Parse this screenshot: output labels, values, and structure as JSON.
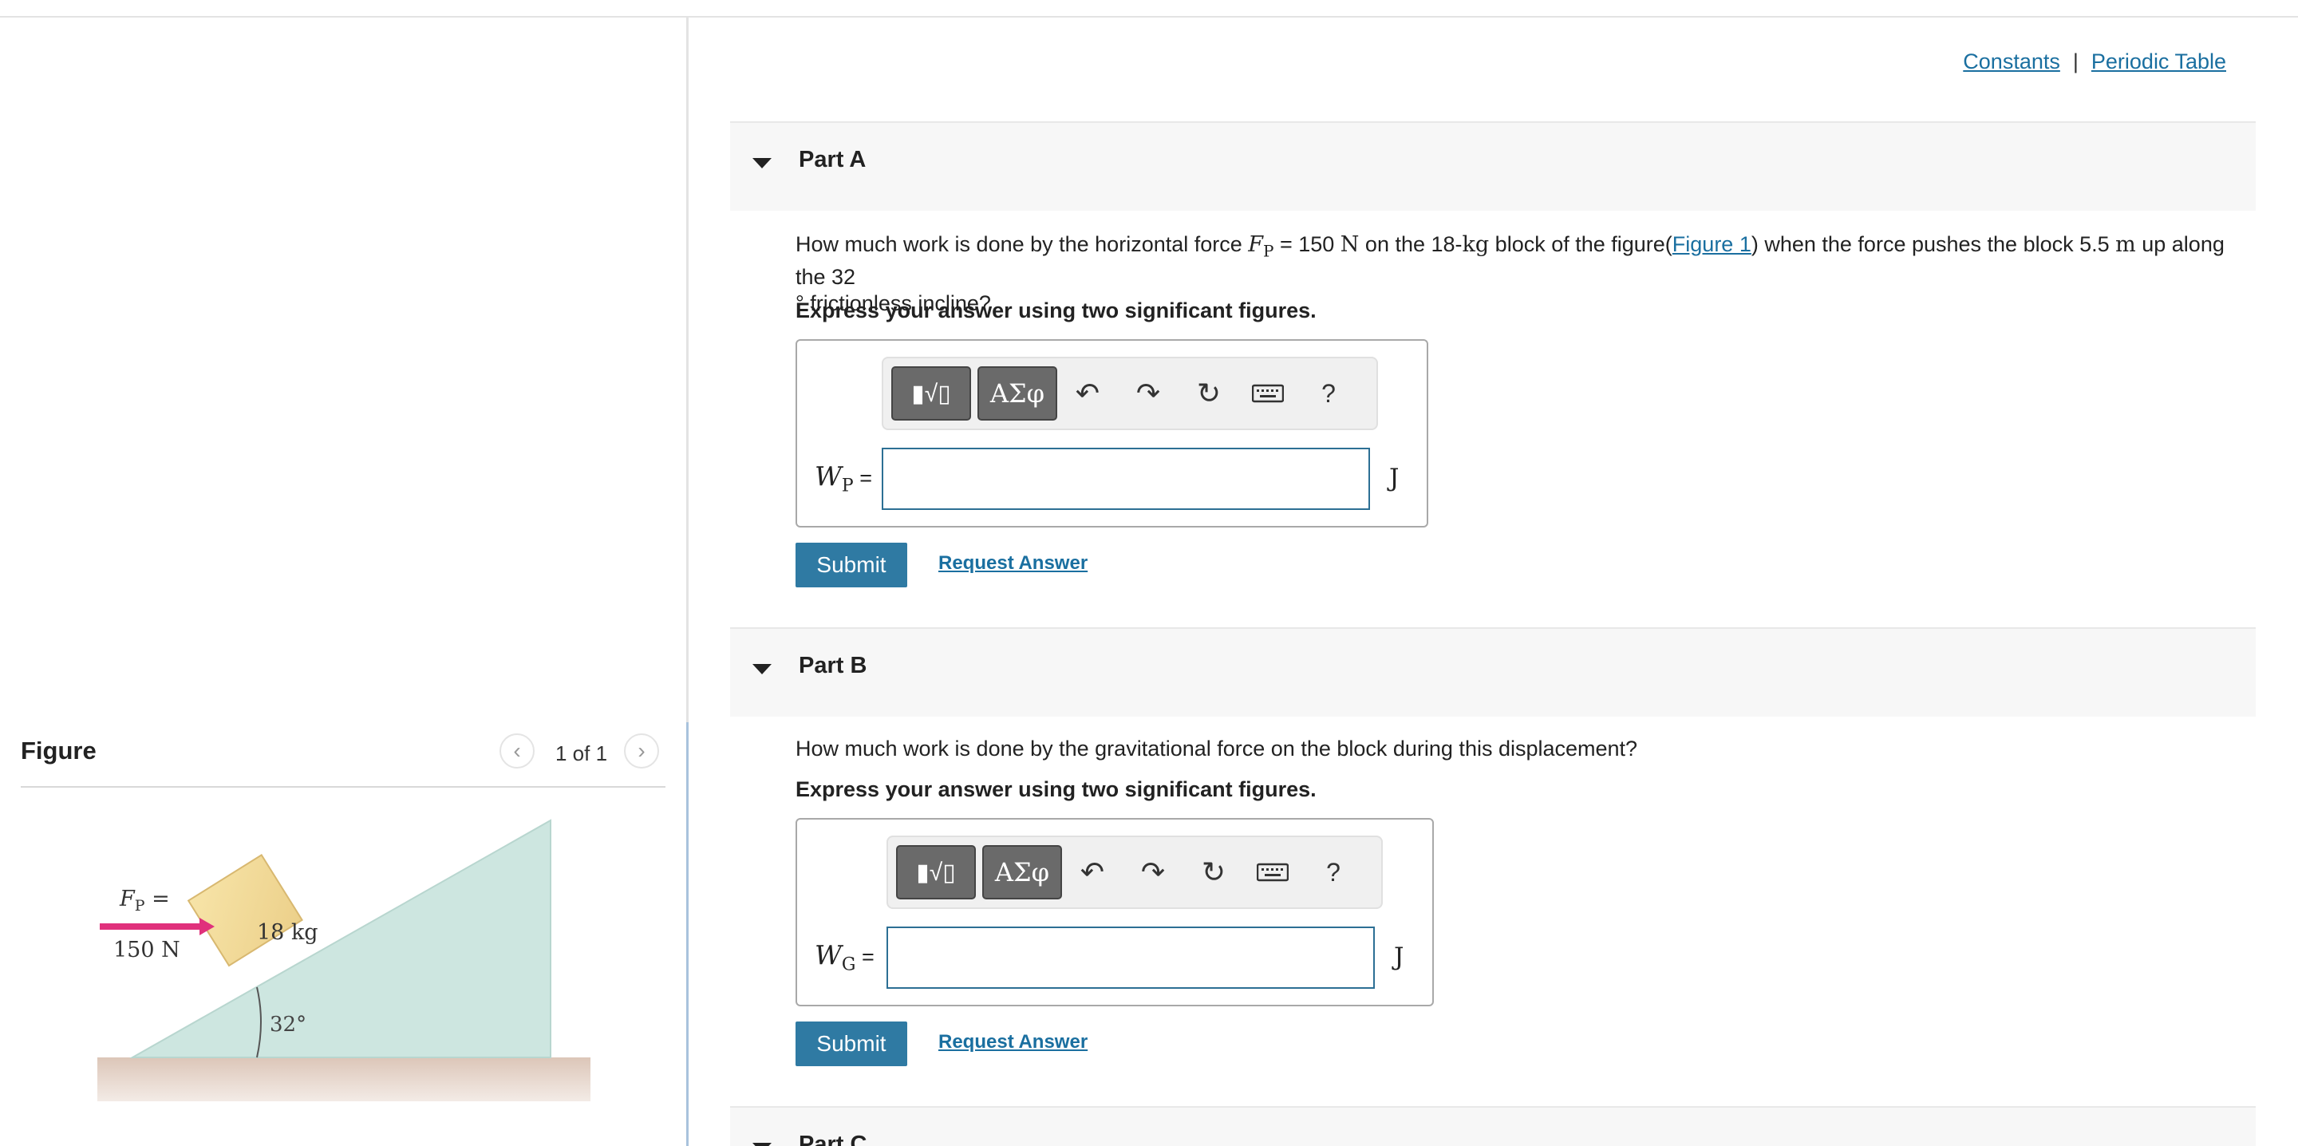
{
  "header_links": {
    "constants": "Constants",
    "separator": "|",
    "periodic_table": "Periodic Table"
  },
  "figure": {
    "title": "Figure",
    "pager": "1 of 1",
    "force_label": "F",
    "force_sub": "P",
    "force_eq": " =",
    "force_value": "150 N",
    "mass_label": "18 kg",
    "angle_label": "32°"
  },
  "toolbar": {
    "templates_label": "▮√▯",
    "symbols_label": "ΑΣφ",
    "help_label": "?"
  },
  "parts": [
    {
      "label": "Part A",
      "question": {
        "p1": "How much work is done by the horizontal force ",
        "var": "F",
        "var_sub": "P",
        "p2": " = 150 ",
        "unit_n": "N",
        "p3": " on the 18-",
        "unit_kg": "kg",
        "p4": " block of the figure(",
        "link": "Figure 1",
        "p5": ") when the force pushes the block 5.5 ",
        "unit_m": "m",
        "p6": " up along the 32",
        "p7": "° frictionless incline?"
      },
      "instruction": "Express your answer using two significant figures.",
      "var_symbol": "W",
      "var_sub": "P",
      "var_eq": " =",
      "input_value": "",
      "unit": "J",
      "submit": "Submit",
      "request": "Request Answer"
    },
    {
      "label": "Part B",
      "question_text": "How much work is done by the gravitational force on the block during this displacement?",
      "instruction": "Express your answer using two significant figures.",
      "var_symbol": "W",
      "var_sub": "G",
      "var_eq": " =",
      "input_value": "",
      "unit": "J",
      "submit": "Submit",
      "request": "Request Answer"
    },
    {
      "label": "Part C"
    }
  ]
}
